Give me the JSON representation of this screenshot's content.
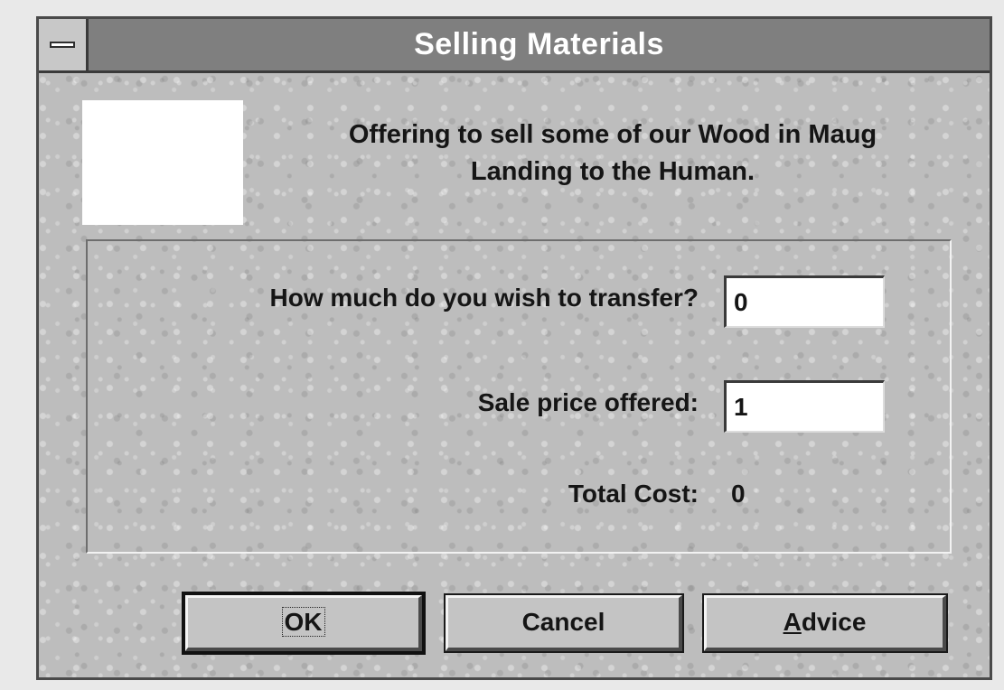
{
  "window": {
    "title": "Selling Materials"
  },
  "description": {
    "line1": "Offering to sell some of our Wood in Maug",
    "line2": "Landing to the Human."
  },
  "form": {
    "transfer_label": "How much do you wish to transfer?",
    "transfer_value": "0",
    "price_label": "Sale price offered:",
    "price_value": "1",
    "total_label": "Total Cost:",
    "total_value": "0"
  },
  "buttons": {
    "ok": "OK",
    "cancel": "Cancel",
    "advice_accel": "A",
    "advice_rest": "dvice"
  },
  "colors": {
    "title_bar": "#7f7f7f",
    "dialog_background": "#bdbdbd"
  },
  "icons": {
    "system_menu": "minus-bar-icon"
  }
}
